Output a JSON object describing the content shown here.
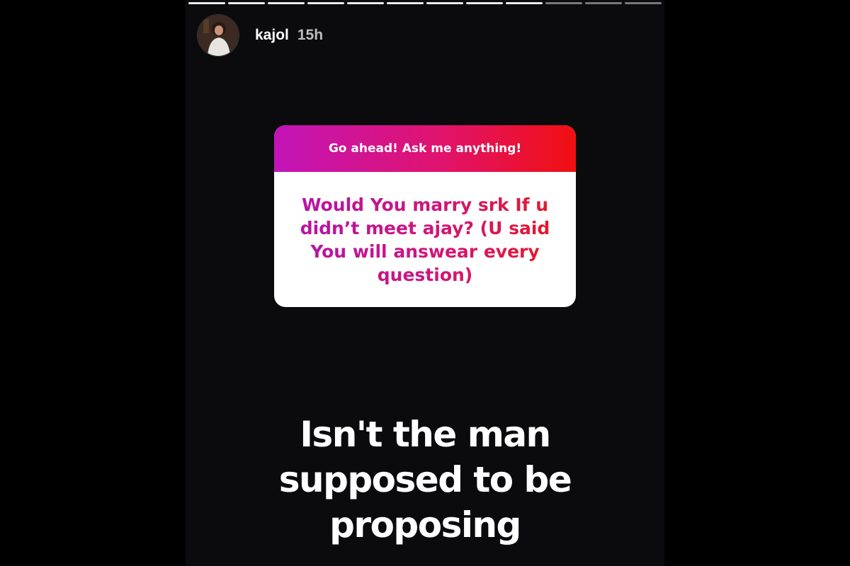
{
  "story": {
    "progress_segments_total": 12,
    "progress_segments_done": 9
  },
  "header": {
    "username": "kajol",
    "time": "15h",
    "avatar_icon": "profile-avatar-icon"
  },
  "question_sticker": {
    "prompt": "Go ahead! Ask me anything!",
    "question": "Would You marry srk If u didn’t meet ajay? (U said You will answear every question)",
    "gradient_colors": [
      "#c214b8",
      "#f01010"
    ]
  },
  "caption": {
    "text": "Isn't the man supposed to be proposing"
  }
}
